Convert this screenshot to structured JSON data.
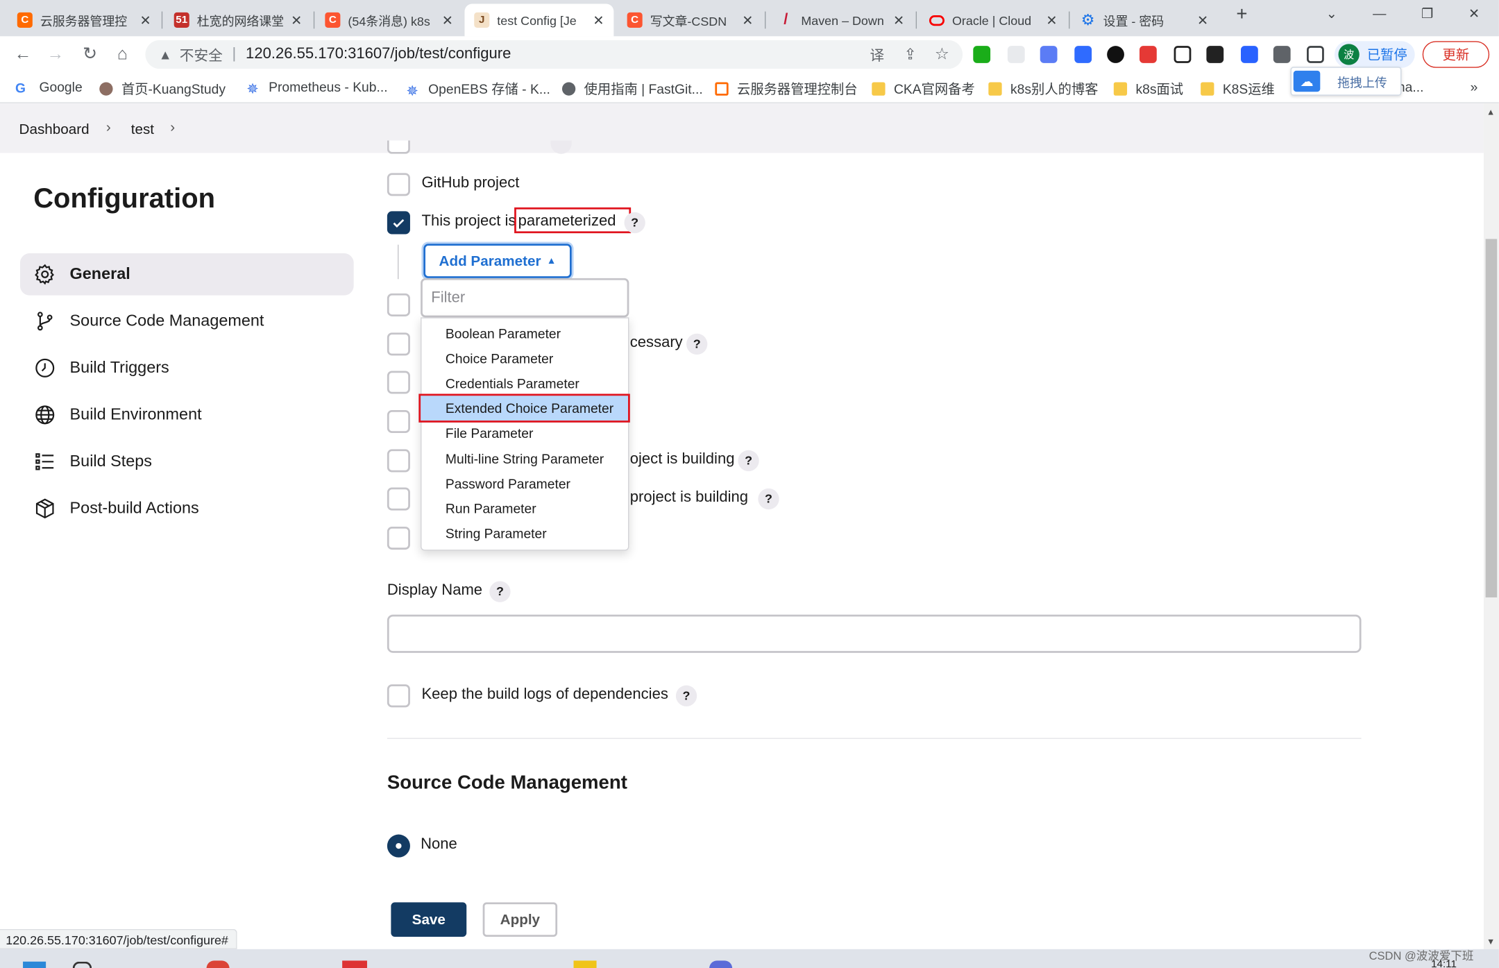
{
  "browser": {
    "tabs": [
      {
        "title": "云服务器管理控",
        "color": "#ff6a00",
        "icon": "C"
      },
      {
        "title": "杜宽的网络课堂",
        "color": "#c4302b",
        "icon": "51"
      },
      {
        "title": "(54条消息) k8s",
        "color": "#fc5531",
        "icon": "C"
      },
      {
        "title": "test Config [Je",
        "color": "#d33833",
        "icon": "J"
      },
      {
        "title": "写文章-CSDN",
        "color": "#fc5531",
        "icon": "C"
      },
      {
        "title": "Maven – Down",
        "color": "#c71a36",
        "icon": "/"
      },
      {
        "title": "Oracle | Cloud",
        "color": "#f80000",
        "icon": "O"
      },
      {
        "title": "设置 - 密码",
        "color": "#1a73e8",
        "icon": "⚙"
      }
    ],
    "security_label": "不安全",
    "url": "120.26.55.170:31607/job/test/configure",
    "profile_badge": "波",
    "paused_label": "已暂停",
    "update_label": "更新",
    "bookmarks": [
      "Google",
      "首页-KuangStudy",
      "Prometheus - Kub...",
      "OpenEBS 存储 - K...",
      "使用指南 | FastGit...",
      "云服务器管理控制台",
      "CKA官网备考",
      "k8s别人的博客",
      "k8s面试",
      "K8S运维"
    ],
    "overflow_bookmark": "na...",
    "upload_popup": "拖拽上传",
    "status_url": "120.26.55.170:31607/job/test/configure#"
  },
  "breadcrumb": {
    "items": [
      "Dashboard",
      "test"
    ]
  },
  "sidebar": {
    "title": "Configuration",
    "items": [
      {
        "label": "General",
        "icon": "gear-icon"
      },
      {
        "label": "Source Code Management",
        "icon": "branch-icon"
      },
      {
        "label": "Build Triggers",
        "icon": "clock-icon"
      },
      {
        "label": "Build Environment",
        "icon": "globe-icon"
      },
      {
        "label": "Build Steps",
        "icon": "list-icon"
      },
      {
        "label": "Post-build Actions",
        "icon": "cube-icon"
      }
    ]
  },
  "general": {
    "github_project": "GitHub project",
    "parameterized_prefix": "This project is",
    "parameterized_word": "parameterized",
    "add_parameter": "Add Parameter",
    "filter_placeholder": "Filter",
    "parameter_types": [
      "Boolean Parameter",
      "Choice Parameter",
      "Credentials Parameter",
      "Extended Choice Parameter",
      "File Parameter",
      "Multi-line String Parameter",
      "Password Parameter",
      "Run Parameter",
      "String Parameter"
    ],
    "highlighted_type": "Extended Choice Parameter",
    "partial_necessary": "cessary",
    "partial_building1": "oject is building",
    "partial_building2": "project is building",
    "display_name_label": "Display Name",
    "display_name_value": "",
    "keep_logs": "Keep the build logs of dependencies"
  },
  "scm": {
    "heading": "Source Code Management",
    "none_label": "None"
  },
  "buttons": {
    "save": "Save",
    "apply": "Apply"
  },
  "watermark": "CSDN @波波爱下班",
  "clock": "14:11"
}
